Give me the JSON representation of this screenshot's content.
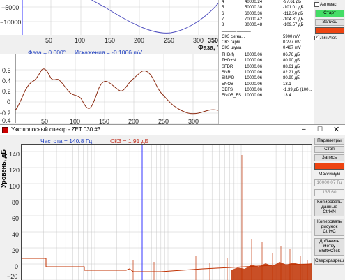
{
  "top": {
    "sine_y_ticks": [
      "−5000",
      "−10000"
    ],
    "sine_x_ticks": [
      "50",
      "100",
      "150",
      "200",
      "250",
      "300",
      "350"
    ],
    "phase_axis_label": "Фаза, °",
    "phase_label": "Фаза = 0.000°",
    "distortion_label": "Искажения = -0.1066 mV",
    "dist_unit": "mV",
    "dist_y_ticks": [
      "0.6",
      "0.4",
      "0.2",
      "0",
      "-0.2",
      "-0.4"
    ],
    "dist_x_ticks": [
      "50",
      "100",
      "150",
      "200",
      "250",
      "300"
    ],
    "harmonics": [
      {
        "n": "4",
        "freq": "40000.24",
        "val": "-97.61 дБ"
      },
      {
        "n": "5",
        "freq": "50000.30",
        "val": "-101.01 дБ"
      },
      {
        "n": "6",
        "freq": "60000.36",
        "val": "-112.50 дБ"
      },
      {
        "n": "7",
        "freq": "70000.42",
        "val": "-104.81 дБ"
      },
      {
        "n": "8",
        "freq": "80000.48",
        "val": "-109.57 дБ"
      }
    ],
    "separator": "______          ______",
    "rms": [
      {
        "name": "СКЗ сигна...",
        "val": "5900 mV"
      },
      {
        "name": "СКЗ гарм...",
        "val": "0.277 mV"
      },
      {
        "name": "СКЗ шума",
        "val": "0.467 mV"
      }
    ],
    "metrics": [
      {
        "name": "THD(f)",
        "freq": "10000.06",
        "val": "86.76 дБ"
      },
      {
        "name": "THD+N",
        "freq": "10000.06",
        "val": "80.90 дБ"
      },
      {
        "name": "SFDR",
        "freq": "10000.06",
        "val": "88.61 дБ"
      },
      {
        "name": "SNR",
        "freq": "10000.06",
        "val": "82.21 дБ"
      },
      {
        "name": "SINAD",
        "freq": "10000.06",
        "val": "80.90 дБ"
      },
      {
        "name": "ENOB",
        "freq": "10000.06",
        "val": "13.1"
      },
      {
        "name": "DBFS",
        "freq": "10000.06",
        "val": "-1.39 дБ (100..."
      },
      {
        "name": "ENOB_FS",
        "freq": "10000.06",
        "val": "13.4"
      }
    ],
    "auto_label": "Автомас.",
    "start_label": "Старт",
    "record_label": "Запись",
    "linlog_label": "Лин./Лог.",
    "start_color": "#44dd66",
    "record_color": "#ee4411"
  },
  "bottom": {
    "title": "Узкополосный спектр - ZET 030 #3",
    "freq_label": "Частота = 140.8 Гц",
    "rms_label": "СКЗ = 1.91 дБ",
    "y_axis_label": "Уровень, дБ",
    "y_ticks": [
      "140",
      "120",
      "100",
      "80",
      "60",
      "40",
      "20",
      "0",
      "−20"
    ],
    "buttons": {
      "params": "Параметры",
      "stop": "Стоп",
      "record": "Запись",
      "max": "Максимум",
      "max_val": "10000.07 Гц",
      "max_db": "135.60",
      "copy_data": "Копировать данные Ctrl+N",
      "copy_pic": "Копировать рисунок Ctrl+C",
      "add_mark": "Добавить метку Shift+Click",
      "overlay": "Сверхразреш"
    },
    "record_color": "#ee4411",
    "spectrum_color": "#c03000",
    "cursor_color": "#3333ff"
  }
}
